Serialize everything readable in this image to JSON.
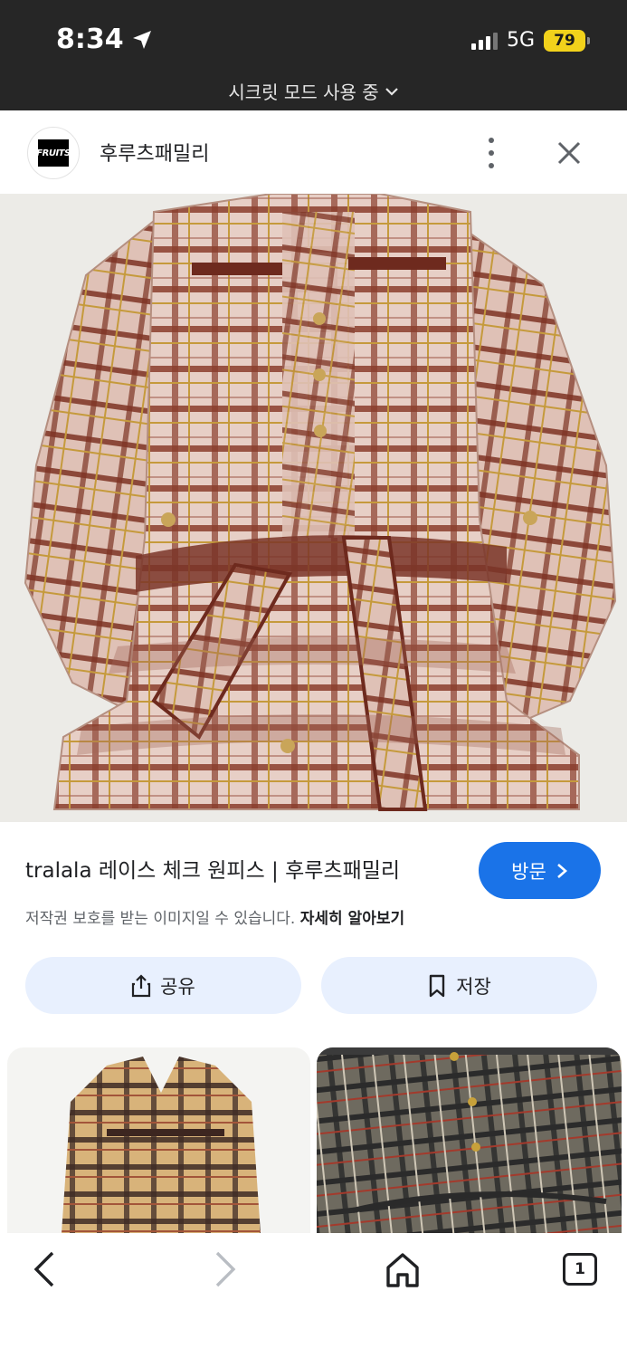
{
  "status_bar": {
    "time": "8:34",
    "network": "5G",
    "battery": "79",
    "mode_label": "시크릿 모드 사용 중"
  },
  "header": {
    "logo_text": "FRUITS",
    "site_name": "후루츠패밀리"
  },
  "result": {
    "caption": "tralala 레이스 체크 원피스 | 후루츠패밀리",
    "copyright_notice": "저작권 보호를 받는 이미지일 수 있습니다.",
    "learn_more": "자세히 알아보기",
    "visit_label": "방문"
  },
  "actions": {
    "share_label": "공유",
    "save_label": "저장"
  },
  "nav": {
    "tab_count": "1"
  },
  "colors": {
    "accent": "#1a73e8",
    "action_bg": "#e8f0fe",
    "status_bar_bg": "#262626",
    "battery": "#f2d21b"
  }
}
